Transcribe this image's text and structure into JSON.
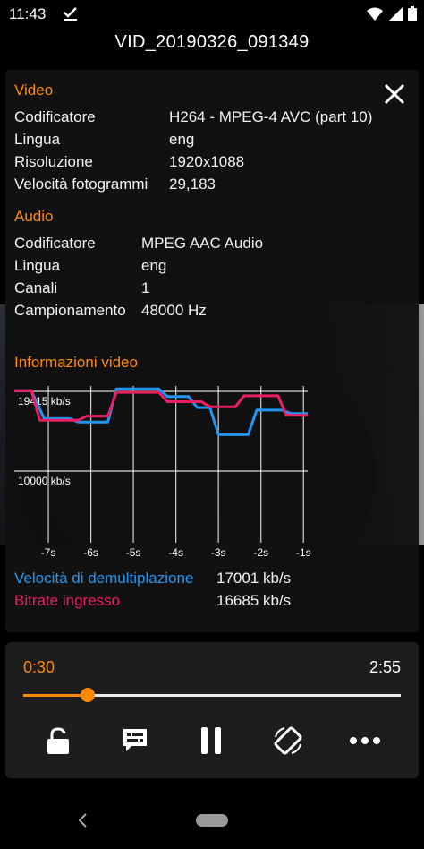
{
  "status_bar": {
    "time": "11:43"
  },
  "header": {
    "title": "VID_20190326_091349"
  },
  "info": {
    "video": {
      "title": "Video",
      "rows": [
        {
          "label": "Codificatore",
          "value": "H264 - MPEG-4 AVC (part 10)"
        },
        {
          "label": "Lingua",
          "value": "eng"
        },
        {
          "label": "Risoluzione",
          "value": "1920x1088"
        },
        {
          "label": "Velocità fotogrammi",
          "value": "29,183"
        }
      ]
    },
    "audio": {
      "title": "Audio",
      "rows": [
        {
          "label": "Codificatore",
          "value": "MPEG AAC Audio"
        },
        {
          "label": "Lingua",
          "value": "eng"
        },
        {
          "label": "Canali",
          "value": "1"
        },
        {
          "label": "Campionamento",
          "value": "48000 Hz"
        }
      ]
    },
    "graph_title": "Informazioni video",
    "legend": [
      {
        "label": "Velocità di demultiplazione",
        "value": "17001 kb/s",
        "color": "#2196f3"
      },
      {
        "label": "Bitrate ingresso",
        "value": "16685 kb/s",
        "color": "#e91e63"
      }
    ]
  },
  "chart_data": {
    "type": "line",
    "x_tick_labels": [
      "-7s",
      "-6s",
      "-5s",
      "-4s",
      "-3s",
      "-2s",
      "-1s"
    ],
    "y_ref_labels": [
      "19415 kb/s",
      "10000 kb/s"
    ],
    "y_refs": [
      19415,
      10000
    ],
    "series": [
      {
        "name": "Velocità di demultiplazione",
        "color": "#2196f3",
        "points": [
          [
            -7.8,
            19500
          ],
          [
            -7.4,
            19500
          ],
          [
            -7.1,
            16200
          ],
          [
            -6.5,
            16200
          ],
          [
            -6.3,
            15800
          ],
          [
            -5.6,
            15800
          ],
          [
            -5.4,
            19700
          ],
          [
            -4.4,
            19700
          ],
          [
            -4.2,
            18800
          ],
          [
            -3.7,
            18800
          ],
          [
            -3.5,
            17500
          ],
          [
            -3.2,
            17500
          ],
          [
            -3.0,
            14300
          ],
          [
            -2.3,
            14300
          ],
          [
            -2.1,
            17200
          ],
          [
            -1.5,
            17200
          ],
          [
            -1.3,
            16800
          ],
          [
            -0.9,
            16800
          ]
        ]
      },
      {
        "name": "Bitrate ingresso",
        "color": "#e91e63",
        "points": [
          [
            -7.8,
            19500
          ],
          [
            -7.4,
            19500
          ],
          [
            -7.2,
            16000
          ],
          [
            -6.3,
            16000
          ],
          [
            -6.1,
            16500
          ],
          [
            -5.6,
            16500
          ],
          [
            -5.4,
            19300
          ],
          [
            -4.4,
            19300
          ],
          [
            -4.2,
            18200
          ],
          [
            -3.4,
            18200
          ],
          [
            -3.2,
            17600
          ],
          [
            -2.6,
            17600
          ],
          [
            -2.4,
            18900
          ],
          [
            -1.6,
            18900
          ],
          [
            -1.4,
            16600
          ],
          [
            -0.9,
            16600
          ]
        ]
      }
    ]
  },
  "player": {
    "current_time": "0:30",
    "total_time": "2:55",
    "progress": 0.171
  }
}
